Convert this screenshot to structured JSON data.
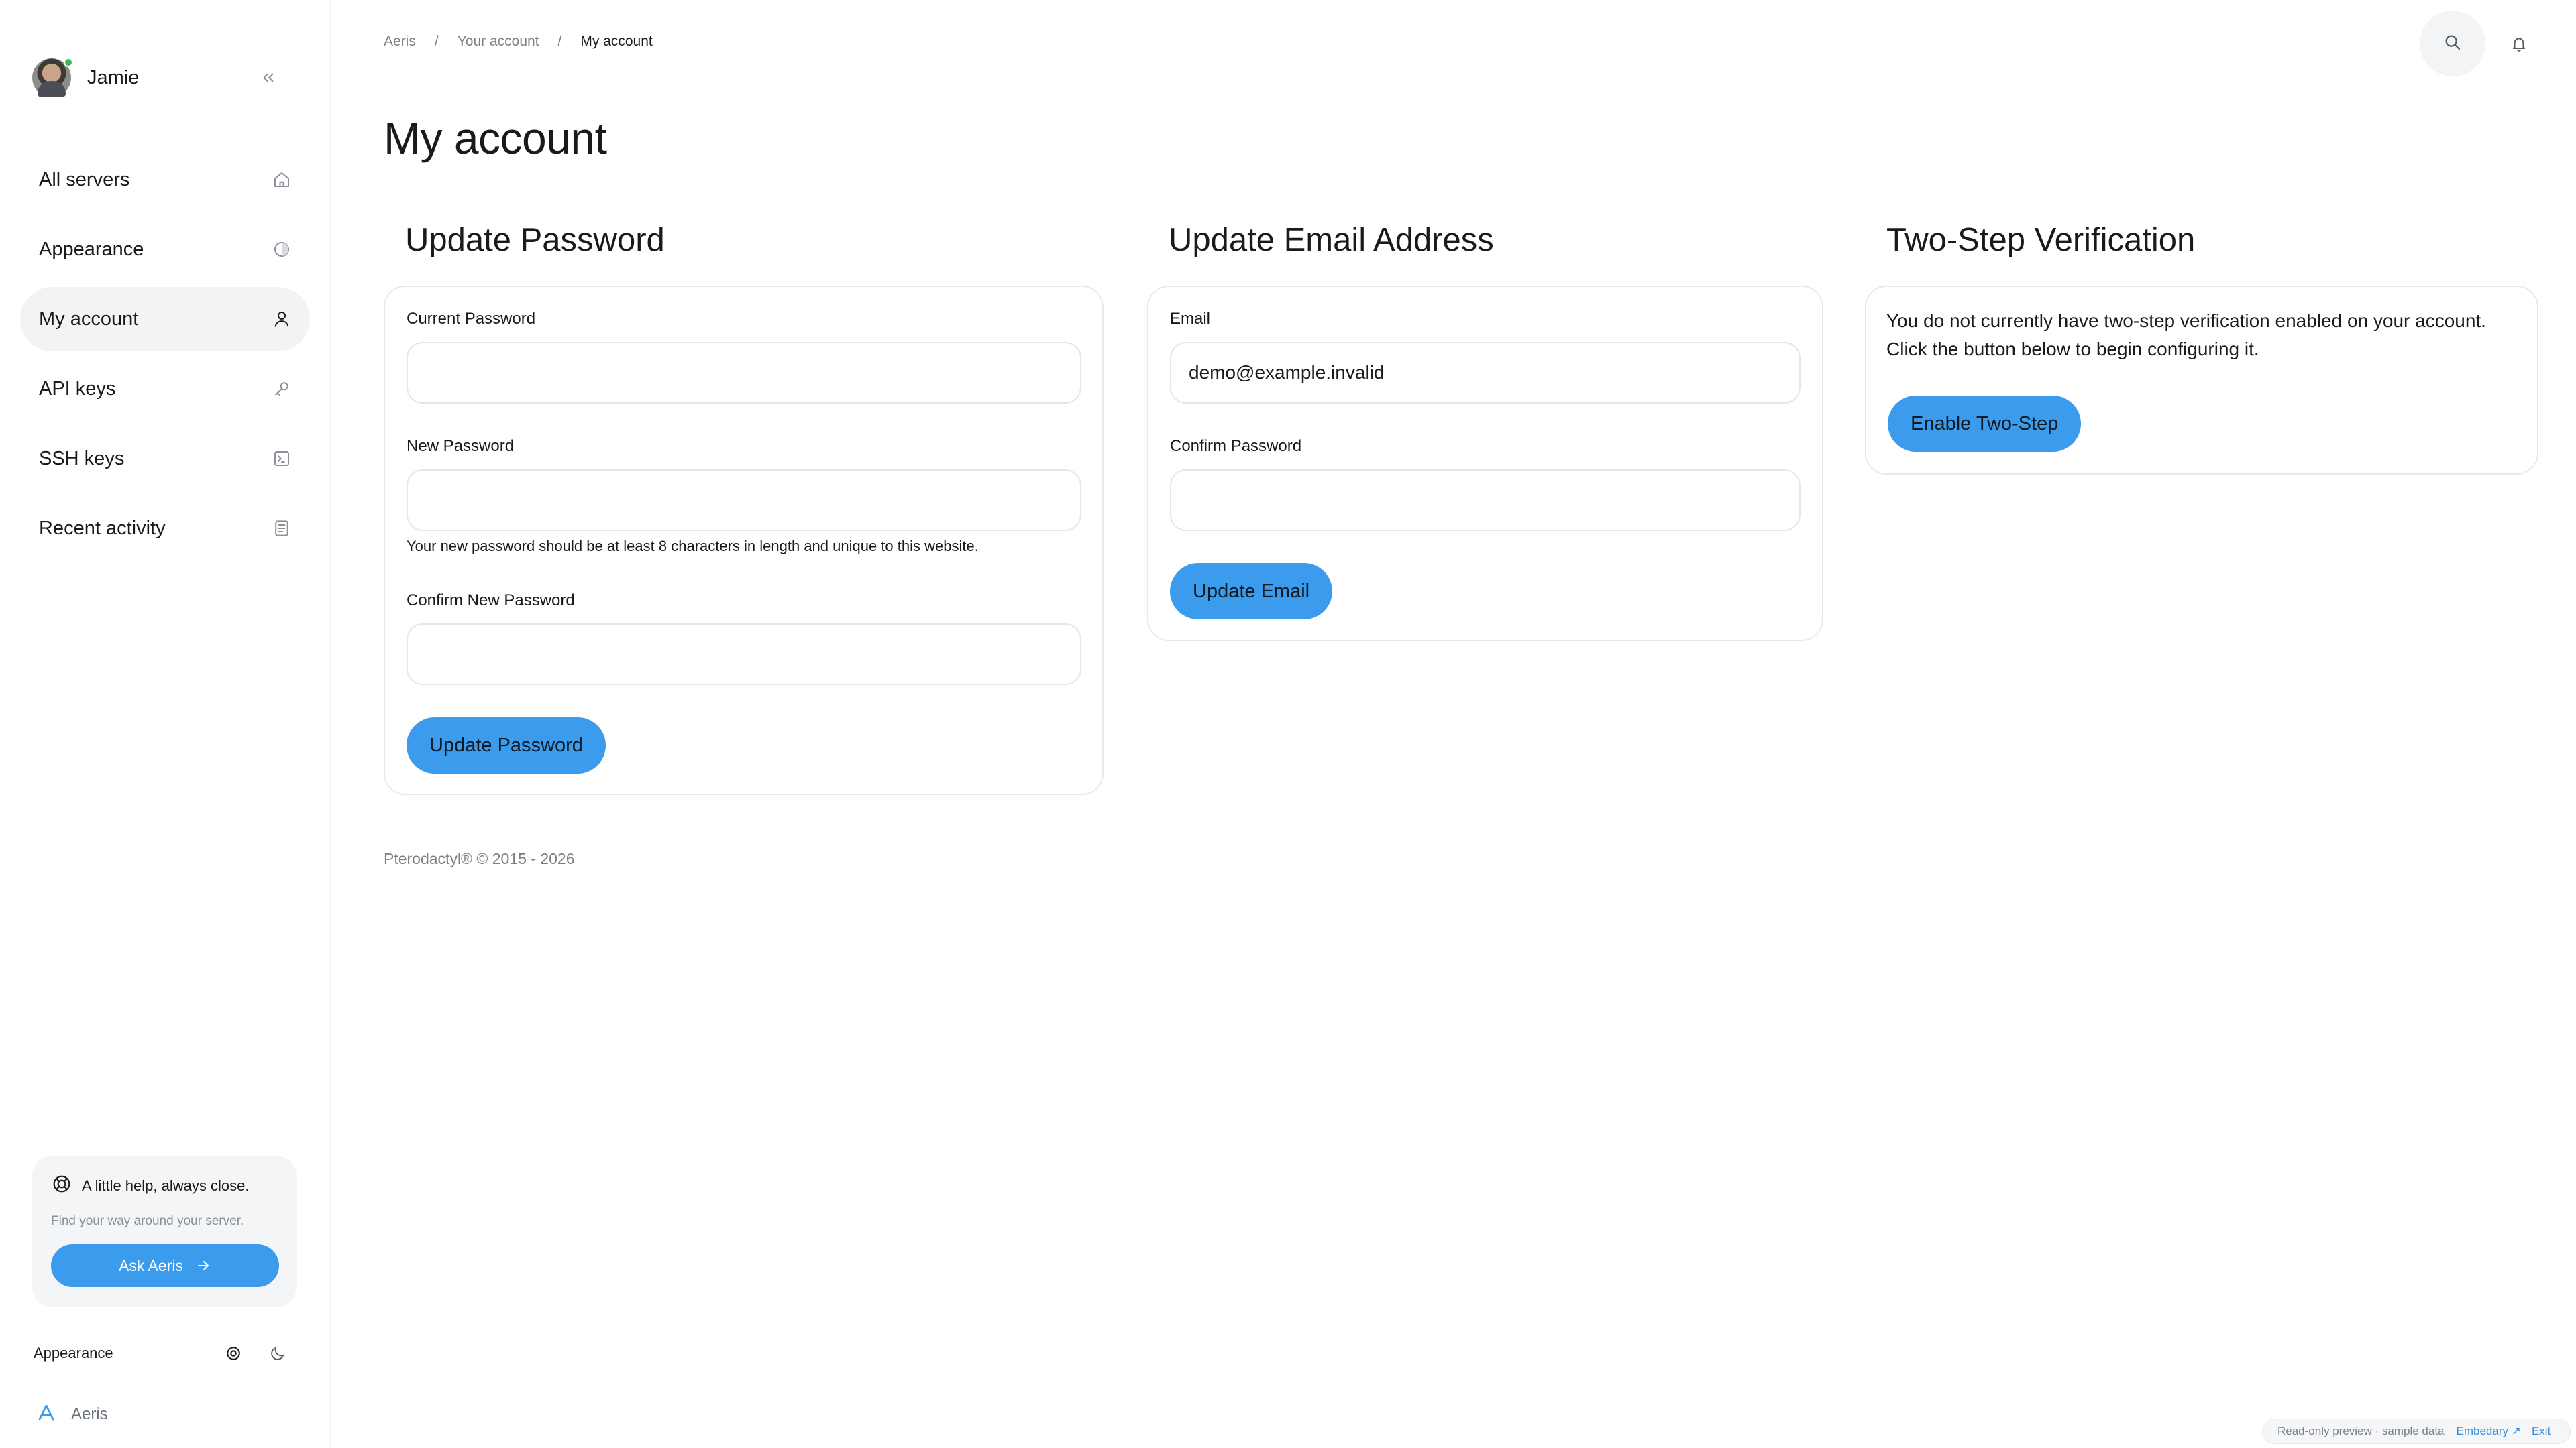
{
  "user": {
    "name": "Jamie"
  },
  "nav": {
    "items": [
      {
        "label": "All servers",
        "icon": "home-icon"
      },
      {
        "label": "Appearance",
        "icon": "palette-icon"
      },
      {
        "label": "My account",
        "icon": "user-icon",
        "active": true
      },
      {
        "label": "API keys",
        "icon": "key-icon"
      },
      {
        "label": "SSH keys",
        "icon": "terminal-icon"
      },
      {
        "label": "Recent activity",
        "icon": "activity-log-icon"
      }
    ]
  },
  "help": {
    "title": "A little help, always close.",
    "subtitle": "Find your way around your server.",
    "button_label": "Ask Aeris"
  },
  "appearance": {
    "label": "Appearance"
  },
  "brand": {
    "name": "Aeris"
  },
  "breadcrumb": {
    "items": [
      "Aeris",
      "Your account",
      "My account"
    ]
  },
  "page": {
    "title": "My account"
  },
  "update_password": {
    "title": "Update Password",
    "current_label": "Current Password",
    "current_value": "",
    "new_label": "New Password",
    "new_value": "",
    "helper": "Your new password should be at least 8 characters in length and unique to this website.",
    "confirm_label": "Confirm New Password",
    "confirm_value": "",
    "button_label": "Update Password"
  },
  "update_email": {
    "title": "Update Email Address",
    "email_label": "Email",
    "email_value": "demo@example.invalid",
    "confirm_label": "Confirm Password",
    "confirm_value": "",
    "button_label": "Update Email"
  },
  "two_step": {
    "title": "Two-Step Verification",
    "text": "You do not currently have two-step verification enabled on your account. Click the button below to begin configuring it.",
    "button_label": "Enable Two-Step"
  },
  "footer": {
    "text": "Pterodactyl® © 2015 - 2026"
  },
  "preview": {
    "text": "Read-only preview · sample data",
    "link": "Embedary ↗",
    "exit": "Exit"
  },
  "colors": {
    "accent": "#3b9ced",
    "active_bg": "#f2f3f5",
    "border": "#e8e9ec",
    "status_online": "#3fb950"
  }
}
